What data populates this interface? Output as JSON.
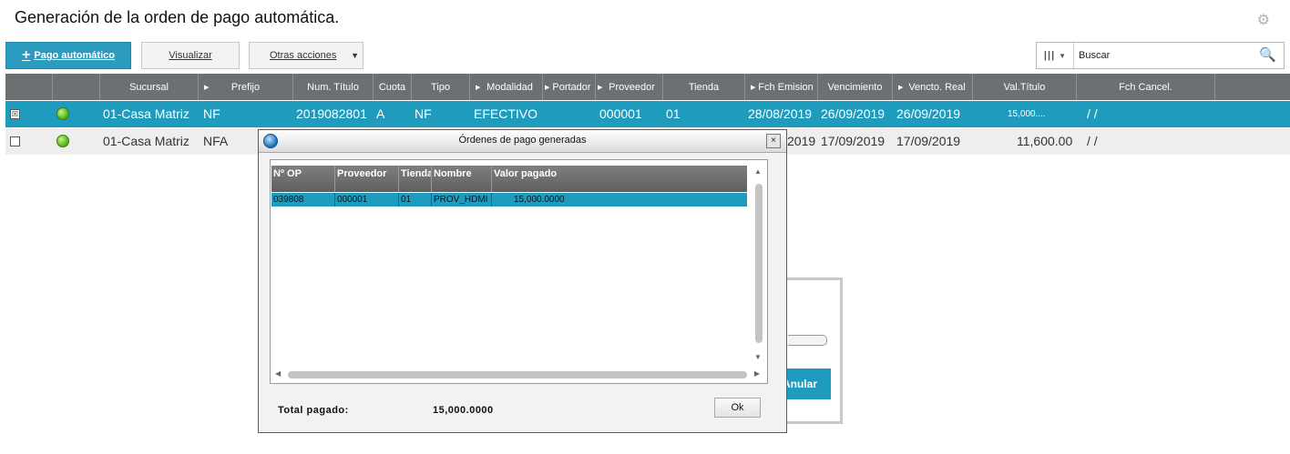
{
  "page": {
    "title": "Generación de la orden de pago automática."
  },
  "toolbar": {
    "primary_label": "Pago automático",
    "primary_icon": "+",
    "visualizar_label": "Visualizar",
    "otras_label": "Otras acciones",
    "otras_caret": "▼"
  },
  "search": {
    "placeholder": "Buscar",
    "columns_icon": "|||",
    "columns_caret": "▼",
    "icon": "🔍"
  },
  "grid": {
    "columns": [
      "Sucursal",
      "Prefijo",
      "Num. Título",
      "Cuota",
      "Tipo",
      "Modalidad",
      "Portador",
      "Proveedor",
      "Tienda",
      "Fch Emision",
      "Vencimiento",
      "Vencto. Real",
      "Val.Título",
      "Fch Cancel."
    ],
    "rows": [
      {
        "checked": true,
        "checkbox": "☒",
        "sucursal": "01-Casa Matriz",
        "prefijo": "NF",
        "num_titulo": "2019082801",
        "cuota": "A",
        "tipo": "NF",
        "modalidad": "EFECTIVO",
        "proveedor": "000001",
        "tienda": "01",
        "fch_emision": "28/08/2019",
        "vencimiento": "26/09/2019",
        "vencto_real": "26/09/2019",
        "val_titulo": "15,000....",
        "fch_cancel": "/ /"
      },
      {
        "checked": false,
        "checkbox": "",
        "sucursal": "01-Casa Matriz",
        "prefijo": "NFA",
        "fch_emision_partial": "2019",
        "vencimiento": "17/09/2019",
        "vencto_real": "17/09/2019",
        "val_titulo": "11,600.00",
        "fch_cancel": "/ /"
      }
    ]
  },
  "background_dialog": {
    "button_label": "Anular"
  },
  "modal": {
    "title": "Órdenes de pago generadas",
    "close_label": "×",
    "table": {
      "columns": [
        "Nº OP",
        "Proveedor",
        "Tienda",
        "Nombre",
        "Valor pagado"
      ],
      "rows": [
        {
          "op": "039808",
          "proveedor": "000001",
          "tienda": "01",
          "nombre": "PROV_HDMI",
          "valor": "15,000.0000"
        }
      ]
    },
    "total_label": "Total pagado:",
    "total_value": "15,000.0000",
    "ok_label": "Ok"
  },
  "colors": {
    "accent": "#1f9bbd",
    "header_bg": "#6b7072",
    "row_alt": "#eeeeee"
  }
}
